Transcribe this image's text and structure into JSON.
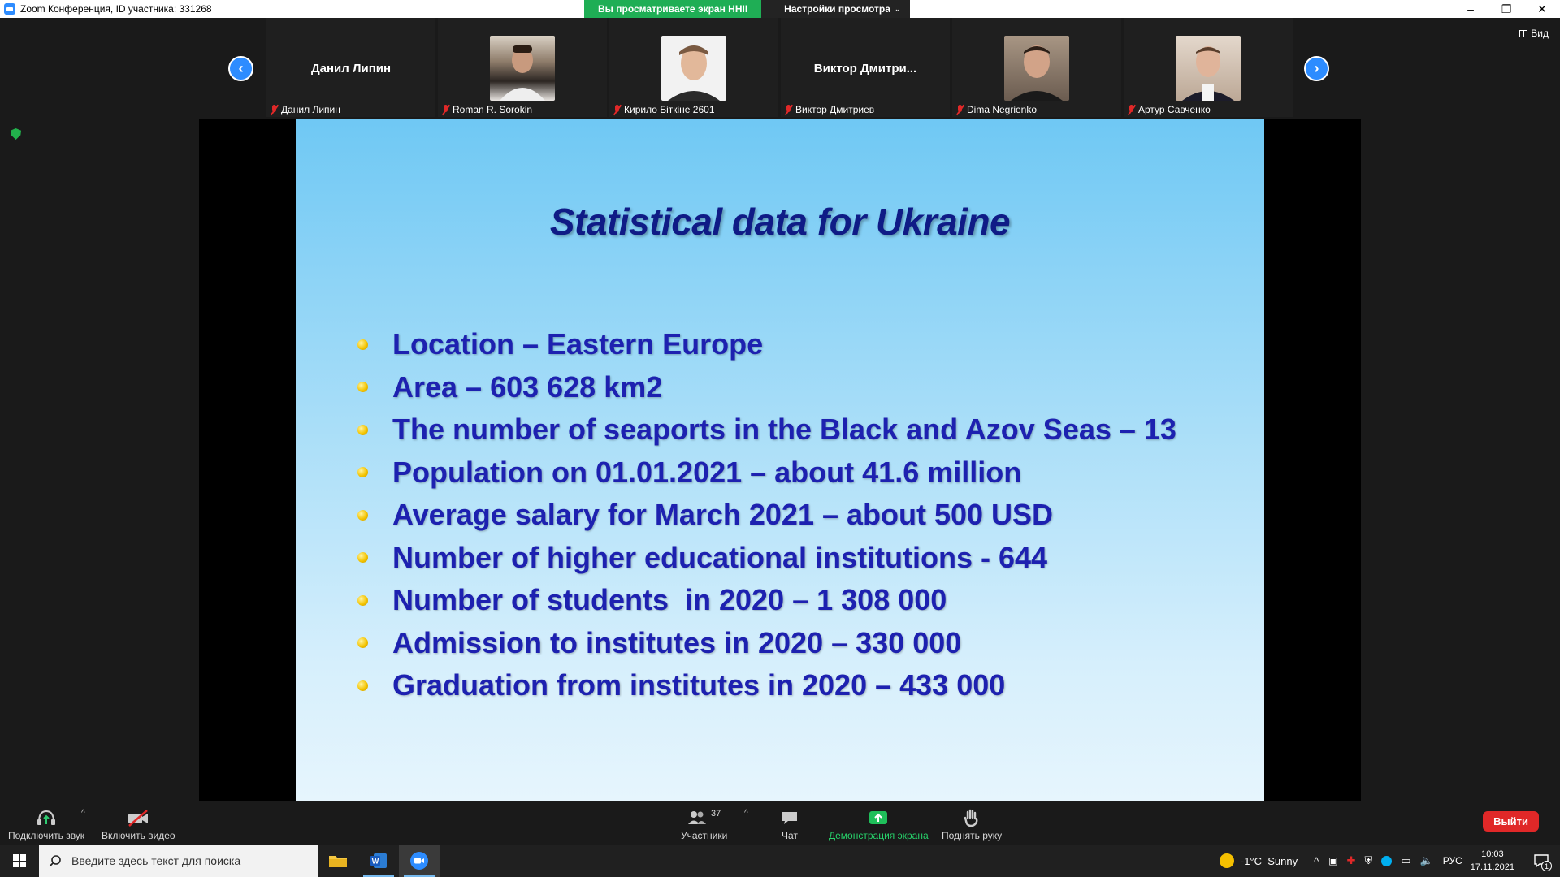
{
  "window": {
    "title": "Zoom Конференция, ID участника: 331268",
    "share_banner": "Вы просматриваете экран HHII",
    "view_options": "Настройки просмотра",
    "minimize": "–",
    "restore": "❐",
    "close": "✕"
  },
  "gallery": {
    "view_label": "Вид",
    "participants": [
      {
        "display": "Данил Липин",
        "name": "Данил Липин",
        "has_video": false
      },
      {
        "display": "",
        "name": "Roman R. Sorokin",
        "has_video": true
      },
      {
        "display": "",
        "name": "Кирило Біткіне 2601",
        "has_video": true
      },
      {
        "display": "Виктор  Дмитри...",
        "name": "Виктор Дмитриев",
        "has_video": false
      },
      {
        "display": "",
        "name": "Dima Negrienko",
        "has_video": true
      },
      {
        "display": "",
        "name": "Артур Савченко",
        "has_video": true
      }
    ]
  },
  "slide": {
    "title": "Statistical data for Ukraine",
    "bullets": [
      "Location – Eastern Europe",
      "Area – 603 628 km2",
      "The number of seaports in the Black and Azov Seas – 13",
      "Population on 01.01.2021 – about 41.6 million",
      "Average salary for March 2021 – about 500 USD",
      "Number of higher educational institutions - 644",
      "Number of students  in 2020 – 1 308 000",
      "Admission to institutes in 2020 – 330 000",
      "Graduation from institutes in 2020 – 433 000"
    ]
  },
  "toolbar": {
    "audio": "Подключить звук",
    "video": "Включить видео",
    "participants": "Участники",
    "participants_count": "37",
    "chat": "Чат",
    "share": "Демонстрация экрана",
    "raise_hand": "Поднять руку",
    "leave": "Выйти",
    "caret": "^"
  },
  "taskbar": {
    "search_placeholder": "Введите здесь текст для поиска",
    "weather": "-1°C  Sunny",
    "language": "РУС",
    "time": "10:03",
    "date": "17.11.2021",
    "notification_count": "1"
  }
}
